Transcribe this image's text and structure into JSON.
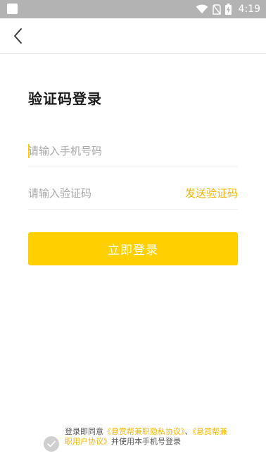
{
  "status_bar": {
    "time": "4:19",
    "icons": [
      "app-notification-icon",
      "wifi-icon",
      "no-sim-icon",
      "battery-charging-icon"
    ]
  },
  "header": {
    "back_icon": "chevron-left-icon"
  },
  "page": {
    "title": "验证码登录"
  },
  "form": {
    "phone_placeholder": "请输入手机号码",
    "code_placeholder": "请输入验证码",
    "send_code_label": "发送验证码",
    "login_button_label": "立即登录"
  },
  "agreement": {
    "prefix": "登录即同意",
    "privacy_link": "《悬赏帮兼职隐私协议》",
    "separator": "、",
    "user_link": "《悬赏帮兼职用户协议》",
    "suffix": "并使用本手机号登录",
    "checkbox_icon": "check-icon"
  },
  "colors": {
    "accent": "#ffd000",
    "link": "#f2b700",
    "status_bar": "#b3b3b3"
  }
}
